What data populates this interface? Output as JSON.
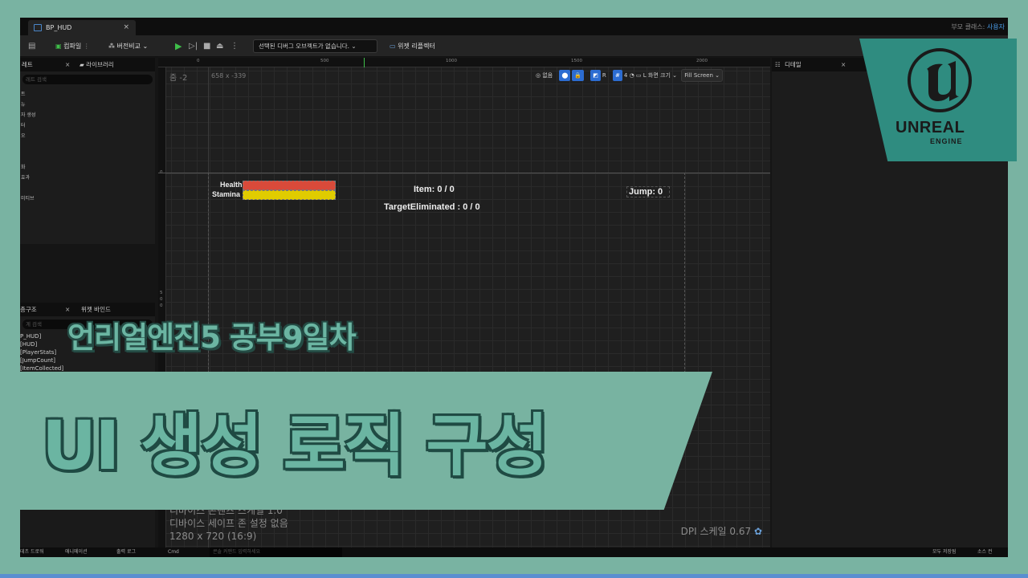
{
  "tab": {
    "title": "BP_HUD",
    "close": "×"
  },
  "parent_class": {
    "label": "부모 클래스:",
    "value": "사용자"
  },
  "toolbar": {
    "compile": "컴파일",
    "diff": "버전비교",
    "debug_select": "선택된 디버그 오브젝트가 없습니다.",
    "widget_reflector": "위젯 리플렉터"
  },
  "palette": {
    "tab1": "레트",
    "tab2": "라이브러리",
    "search": "레트 검색",
    "items": [
      "트",
      "뉴",
      "자 생성",
      "터",
      "오",
      "",
      "",
      "화",
      "효과",
      "",
      "미티브"
    ]
  },
  "hierarchy": {
    "tab1": "층구조",
    "tab2": "위젯 바인드",
    "search": "계 검색",
    "items": [
      "P_HUD]",
      "[HUD]",
      "[PlayerStats]",
      "[JumpCount]",
      "[ItemCollected]"
    ]
  },
  "designer": {
    "zoom": "줌 -2",
    "size": "658 x -339",
    "ruler": [
      "0",
      "500",
      "1000",
      "1500",
      "2000"
    ],
    "ruler_left": [
      "0",
      "5",
      "0",
      "0"
    ],
    "tools": {
      "none": "없음",
      "r": "R",
      "grid": "4",
      "screen_size": "화면 크기",
      "fill": "Fill Screen"
    },
    "info_lines": [
      "디바이스 콘텐츠 스케일 1.0",
      "디바이스 세이프 존 설정 없음",
      "1280 x 720 (16:9)"
    ],
    "dpi": "DPI 스케일 0.67"
  },
  "hud": {
    "health_label": "Health",
    "stamina_label": "Stamina",
    "health_color": "#d94a3a",
    "stamina_color": "#e0cc00",
    "item": "Item: 0 / 0",
    "jump": "Jump: 0",
    "target": "TargetEliminated : 0 / 0"
  },
  "details": {
    "title": "디테일",
    "close": "×"
  },
  "bottom": {
    "left1": "데츠 드로워",
    "left2": "애니메이션",
    "left3": "출력 로그",
    "cmd": "Cmd",
    "console": "콘솔 커맨드 입력하세요",
    "save": "모두 저장됨",
    "source": "소스 컨"
  },
  "logo": {
    "word": "UNREAL",
    "engine": "ENGINE"
  },
  "overlay": {
    "subtitle": "언리얼엔진5 공부9일차",
    "title": "UI 생성 로직 구성"
  }
}
